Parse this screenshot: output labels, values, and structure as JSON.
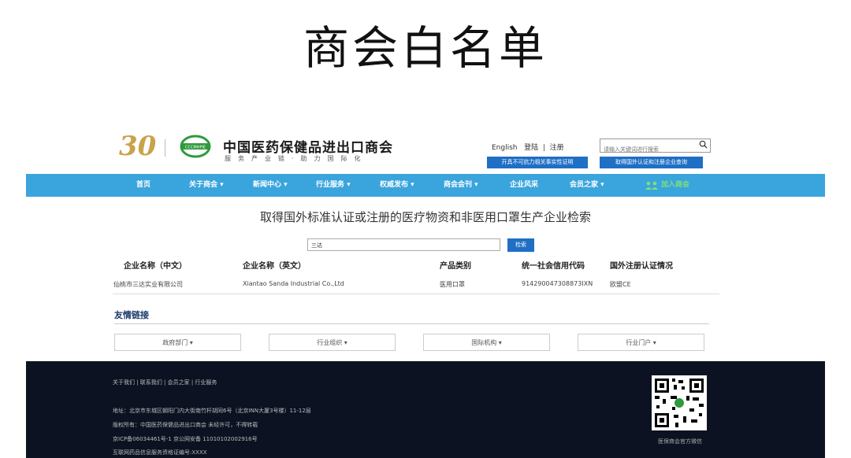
{
  "slide_title": "商会白名单",
  "header": {
    "anniversary": "30",
    "org_badge": "CCCMHPIE",
    "org_name_cn": "中国医药保健品进出口商会",
    "slogan": "服务产业链·助力国际化",
    "lang_link": "English",
    "login": "登陆",
    "register": "注册",
    "sep": "|",
    "search_placeholder": "请输入关键词进行搜索",
    "btn_force_majeure": "开具不可抗力相关事实性证明",
    "btn_cert_query": "取得国外认证和注册企业查询"
  },
  "nav": [
    {
      "label": "首页"
    },
    {
      "label": "关于商会 ▾"
    },
    {
      "label": "新闻中心 ▾"
    },
    {
      "label": "行业服务 ▾"
    },
    {
      "label": "权威发布 ▾"
    },
    {
      "label": "商会会刊 ▾"
    },
    {
      "label": "企业风采"
    },
    {
      "label": "会员之家 ▾"
    },
    {
      "label": "加入商会"
    }
  ],
  "main": {
    "title": "取得国外标准认证或注册的医疗物资和非医用口罩生产企业检索",
    "query_value": "三达",
    "search_button": "检索",
    "columns": [
      "企业名称（中文）",
      "企业名称（英文）",
      "产品类别",
      "统一社会信用代码",
      "国外注册认证情况"
    ],
    "rows": [
      [
        "仙桃市三达实业有限公司",
        "Xiantao Sanda Industrial Co.,Ltd",
        "医用口罩",
        "914290047308873IXN",
        "欧盟CE"
      ]
    ]
  },
  "friend_links": {
    "title": "友情链接",
    "dropdowns": [
      "政府部门 ▾",
      "行业组织 ▾",
      "国际机构 ▾",
      "行业门户 ▾"
    ]
  },
  "footer": {
    "links": "关于我们  |  联系我们  |  会员之家  |  行业服务",
    "address": "地址：北京市东城区朝阳门内大街南竹杆胡同6号（北京INN大厦3号楼）11-12层",
    "copyright": "版权所有：中国医药保健品进出口商会 未经许可，不得转载",
    "icp": "京ICP备06034461号-1 京公网安备 11010102002916号",
    "license": "互联网药品信息服务资格证编号:XXXX",
    "qr_caption": "医保商会官方微信"
  },
  "colors": {
    "nav_blue": "#3aa4dc",
    "button_blue": "#1f6fc5",
    "footer_dark": "#0c1222",
    "gold": "#c9a24a",
    "logo_green": "#2e9a3e"
  }
}
